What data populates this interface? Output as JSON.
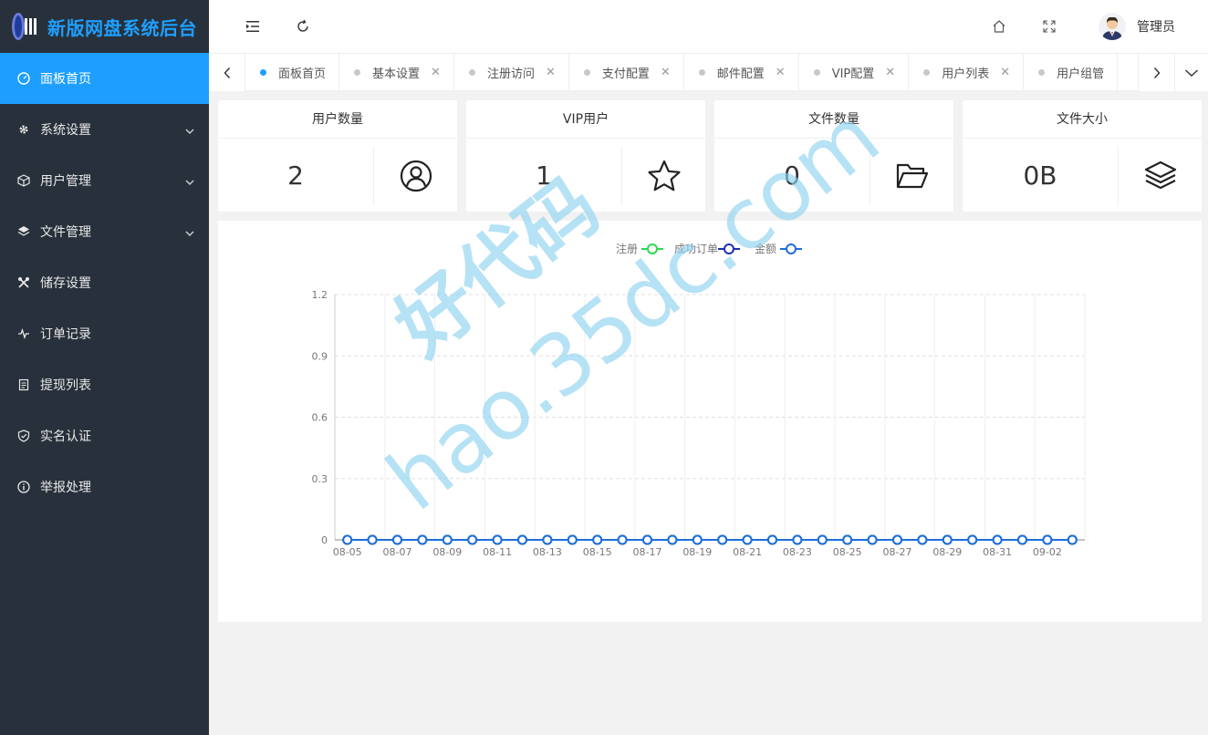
{
  "app": {
    "title": "新版网盘系统后台",
    "logo_text": "网盘"
  },
  "sidebar": {
    "items": [
      {
        "label": "面板首页",
        "icon": "dashboard-icon",
        "active": true,
        "has_children": false
      },
      {
        "label": "系统设置",
        "icon": "gear-icon",
        "active": false,
        "has_children": true
      },
      {
        "label": "用户管理",
        "icon": "cube-icon",
        "active": false,
        "has_children": true
      },
      {
        "label": "文件管理",
        "icon": "layers-icon",
        "active": false,
        "has_children": true
      },
      {
        "label": "储存设置",
        "icon": "tools-icon",
        "active": false,
        "has_children": false
      },
      {
        "label": "订单记录",
        "icon": "pulse-icon",
        "active": false,
        "has_children": false
      },
      {
        "label": "提现列表",
        "icon": "list-icon",
        "active": false,
        "has_children": false
      },
      {
        "label": "实名认证",
        "icon": "shield-check-icon",
        "active": false,
        "has_children": false
      },
      {
        "label": "举报处理",
        "icon": "info-icon",
        "active": false,
        "has_children": false
      }
    ]
  },
  "header": {
    "user_name": "管理员"
  },
  "tabs": [
    {
      "label": "面板首页",
      "active": true,
      "closable": false
    },
    {
      "label": "基本设置",
      "active": false,
      "closable": true
    },
    {
      "label": "注册访问",
      "active": false,
      "closable": true
    },
    {
      "label": "支付配置",
      "active": false,
      "closable": true
    },
    {
      "label": "邮件配置",
      "active": false,
      "closable": true
    },
    {
      "label": "VIP配置",
      "active": false,
      "closable": true
    },
    {
      "label": "用户列表",
      "active": false,
      "closable": true
    },
    {
      "label": "用户组管",
      "active": false,
      "closable": false
    }
  ],
  "cards": [
    {
      "title": "用户数量",
      "value": "2",
      "icon": "user-circle-icon"
    },
    {
      "title": "VIP用户",
      "value": "1",
      "icon": "star-icon"
    },
    {
      "title": "文件数量",
      "value": "0",
      "icon": "folder-open-icon"
    },
    {
      "title": "文件大小",
      "value": "0B",
      "icon": "layers-icon"
    }
  ],
  "watermark": {
    "line1": "好代码",
    "line2": "hao.35dc.com"
  },
  "chart_data": {
    "type": "line",
    "title": "",
    "xlabel": "",
    "ylabel": "",
    "ylim": [
      0,
      1.2
    ],
    "yticks": [
      "0",
      "0.3",
      "0.6",
      "0.9",
      "1.2"
    ],
    "x": [
      "08-05",
      "08-06",
      "08-07",
      "08-08",
      "08-09",
      "08-10",
      "08-11",
      "08-12",
      "08-13",
      "08-14",
      "08-15",
      "08-16",
      "08-17",
      "08-18",
      "08-19",
      "08-20",
      "08-21",
      "08-22",
      "08-23",
      "08-24",
      "08-25",
      "08-26",
      "08-27",
      "08-28",
      "08-29",
      "08-30",
      "08-31",
      "09-01",
      "09-02",
      "09-03"
    ],
    "x_tick_labels": [
      "08-05",
      "08-07",
      "08-09",
      "08-11",
      "08-13",
      "08-15",
      "08-17",
      "08-19",
      "08-21",
      "08-23",
      "08-25",
      "08-27",
      "08-29",
      "08-31",
      "09-02"
    ],
    "grid": true,
    "legend_position": "top-center",
    "series": [
      {
        "name": "注册",
        "color": "#2bd94f",
        "values": [
          0,
          0,
          0,
          0,
          0,
          0,
          0,
          0,
          0,
          0,
          0,
          0,
          0,
          0,
          0,
          0,
          0,
          0,
          0,
          0,
          0,
          0,
          0,
          0,
          0,
          0,
          0,
          0,
          0,
          0
        ]
      },
      {
        "name": "成功订单",
        "color": "#1f2fb3",
        "values": [
          0,
          0,
          0,
          0,
          0,
          0,
          0,
          0,
          0,
          0,
          0,
          0,
          0,
          0,
          0,
          0,
          0,
          0,
          0,
          0,
          0,
          0,
          0,
          0,
          0,
          0,
          0,
          0,
          0,
          0
        ]
      },
      {
        "name": "金额",
        "color": "#1e6fd9",
        "values": [
          0,
          0,
          0,
          0,
          0,
          0,
          0,
          0,
          0,
          0,
          0,
          0,
          0,
          0,
          0,
          0,
          0,
          0,
          0,
          0,
          0,
          0,
          0,
          0,
          0,
          0,
          0,
          0,
          0,
          0
        ]
      }
    ]
  }
}
